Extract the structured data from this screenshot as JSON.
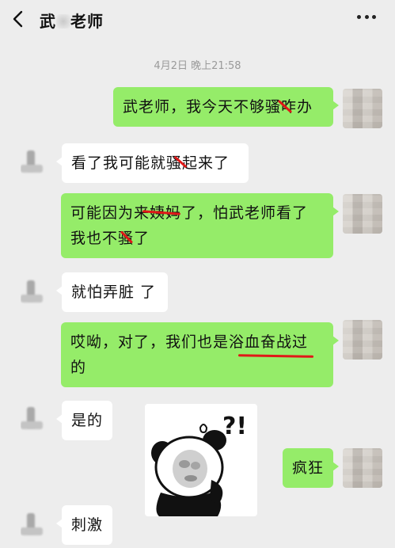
{
  "header": {
    "title_start": "武",
    "title_end": "老师",
    "back_icon": "chevron-left-icon",
    "more_icon": "more-dots-icon"
  },
  "timestamp": "4月2日 晚上21:58",
  "messages": [
    {
      "from": "me",
      "lines": [
        "武老师，我今天不够骚咋办"
      ]
    },
    {
      "from": "them",
      "lines": [
        "看了我可能就骚起来了"
      ]
    },
    {
      "from": "me",
      "lines": [
        "可能因为来姨妈了，怕武老师看了",
        "我也不骚了"
      ]
    },
    {
      "from": "them",
      "lines": [
        "就怕弄脏 了"
      ]
    },
    {
      "from": "me",
      "lines": [
        "哎呦，对了，我们也是浴血奋战过",
        "的"
      ]
    },
    {
      "from": "them",
      "lines": [
        "是的"
      ]
    },
    {
      "from": "them",
      "type": "sticker",
      "sticker_text": "?!",
      "sticker_icon": "panda-meme-sticker"
    },
    {
      "from": "me",
      "lines": [
        "疯狂"
      ]
    },
    {
      "from": "them",
      "lines": [
        "刺激"
      ]
    }
  ],
  "colors": {
    "background": "#ededed",
    "my_bubble": "#95ec69",
    "their_bubble": "#ffffff",
    "annotation_red": "#e01818"
  }
}
